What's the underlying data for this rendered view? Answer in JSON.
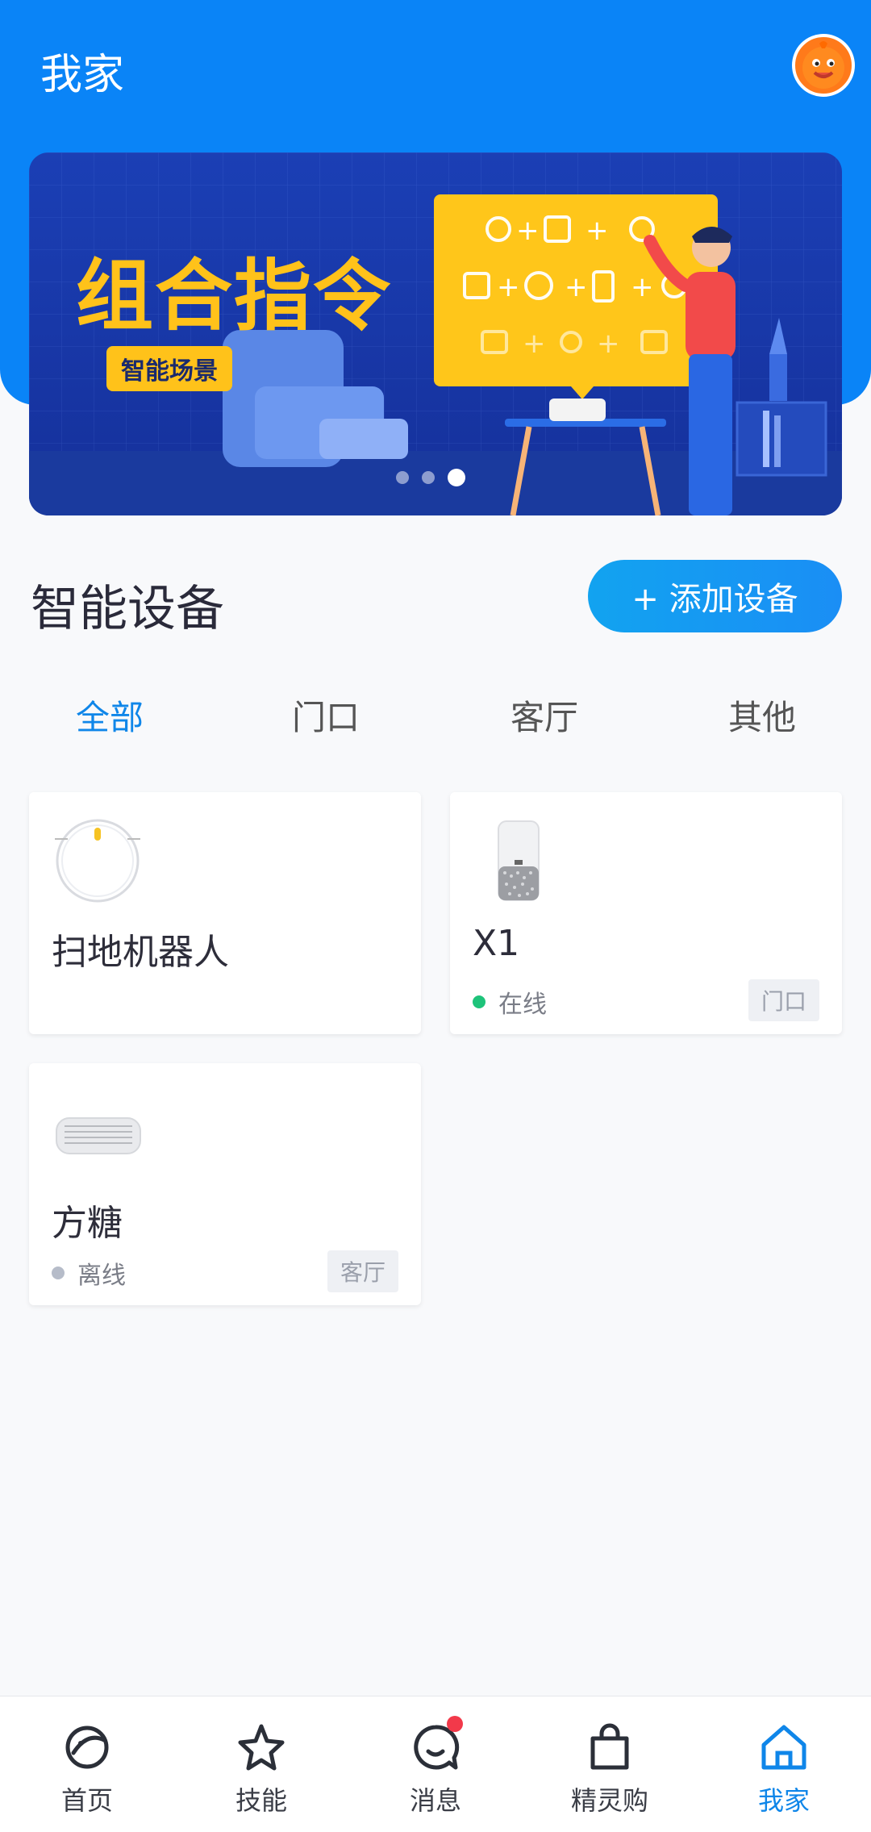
{
  "header": {
    "title": "我家"
  },
  "banner": {
    "title": "组合指令",
    "tag": "智能场景",
    "dots": 3,
    "active_dot": 3
  },
  "devices_section": {
    "title": "智能设备",
    "add_button": "+ 添加设备"
  },
  "tabs": [
    {
      "label": "全部",
      "active": true
    },
    {
      "label": "门口",
      "active": false
    },
    {
      "label": "客厅",
      "active": false
    },
    {
      "label": "其他",
      "active": false
    }
  ],
  "devices": [
    {
      "name": "扫地机器人",
      "status": "",
      "room": "",
      "icon": "robot-vacuum-icon"
    },
    {
      "name": "X1",
      "status": "在线",
      "room": "门口",
      "icon": "air-purifier-icon",
      "status_color": "#1ec37a"
    },
    {
      "name": "方糖",
      "status": "离线",
      "room": "客厅",
      "icon": "smart-speaker-icon",
      "status_color": "#b6bcc9"
    }
  ],
  "tabbar": [
    {
      "label": "首页",
      "icon": "planet-icon"
    },
    {
      "label": "技能",
      "icon": "star-icon"
    },
    {
      "label": "消息",
      "icon": "chat-bubble-icon"
    },
    {
      "label": "精灵购",
      "icon": "shopping-bag-icon"
    },
    {
      "label": "我家",
      "icon": "home-icon",
      "active": true
    }
  ],
  "colors": {
    "primary": "#0a84f7",
    "active_text": "#0f86e9",
    "badge": "#f2394a"
  }
}
